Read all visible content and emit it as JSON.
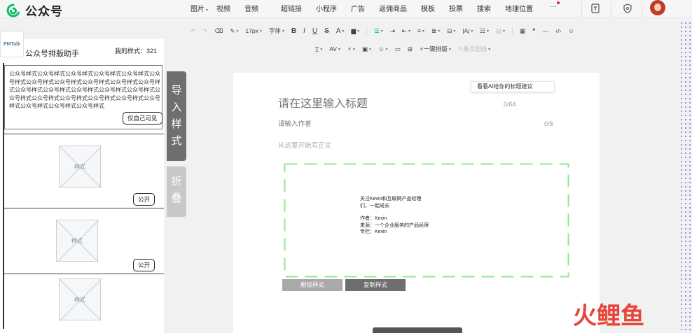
{
  "app": {
    "title": "公众号"
  },
  "menu": [
    {
      "label": "图片",
      "has_caret": true
    },
    {
      "label": "视频",
      "has_caret": false
    },
    {
      "label": "音频",
      "has_caret": false
    },
    {
      "label": "超链接",
      "has_caret": false
    },
    {
      "label": "小程序",
      "has_caret": false
    },
    {
      "label": "广告",
      "has_caret": false
    },
    {
      "label": "返佣商品",
      "has_caret": false
    },
    {
      "label": "模板",
      "has_caret": false
    },
    {
      "label": "投票",
      "has_caret": false
    },
    {
      "label": "搜索",
      "has_caret": false
    },
    {
      "label": "地理位置",
      "has_caret": false
    },
    {
      "label": "···",
      "has_caret": false
    }
  ],
  "top_icons": [
    "document-icon",
    "shield-icon",
    "avatar"
  ],
  "toolbar": {
    "font_size": "17px",
    "font_family": "字体",
    "one_click_format": "一键排版",
    "highlight_line": "重点划线"
  },
  "left_panel": {
    "badge": "PMTalk",
    "title": "公众号排版助手",
    "my_styles": "我的样式：321",
    "card_text": "公众号样式公众号样式公众号样式公众号样式公众号样式公众号样式公众号样式公众号样式公众号样式公众号样式公众号样式公众号样式公众号样式公众号样式公众号样式公众号样式公众号样式公众号样式公众号样式公众号样式公众号样式公众号样式公众号样式公众号样式公众号样式",
    "private_label": "仅自己可见",
    "public_label": "公开",
    "thumb_label": "样式"
  },
  "side_tabs": {
    "import": "导入样式",
    "fold": "折叠"
  },
  "editor": {
    "ai_hint": "看看AI给你的标题建议",
    "title_placeholder": "请在这里输入标题",
    "title_count": "0/64",
    "author_placeholder": "请输入作者",
    "author_count": "0/8",
    "body_placeholder": "从这里开始写正文"
  },
  "insert_block": {
    "line1": "关注Kevin和互联网产品经理",
    "line2": "们，一起成长",
    "author": "作者：Kevin",
    "source": "来源：一个企业服务的产品经理",
    "column": "专栏：Kevin"
  },
  "buttons": {
    "delete_style": "删除样式",
    "copy_style": "复制样式"
  },
  "watermark": "火鲤鱼",
  "colors": {
    "brand_green": "#07c160",
    "dash_green": "#8de98d",
    "watermark_red": "#e8443a",
    "watermark_blue": "#2f5fb3"
  }
}
